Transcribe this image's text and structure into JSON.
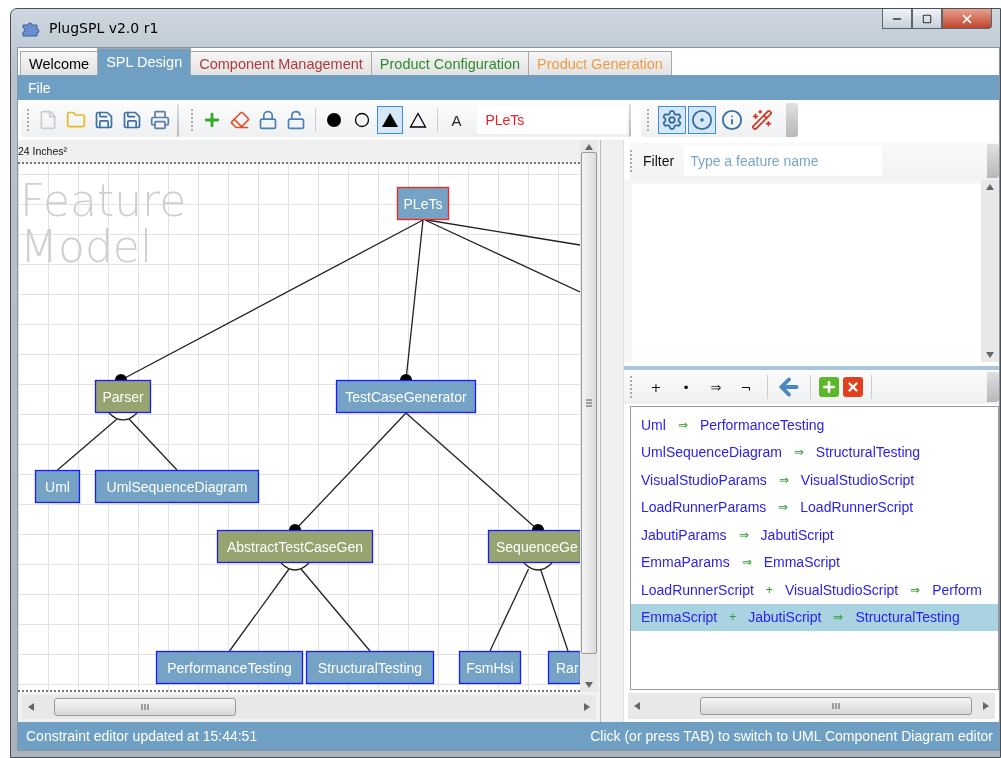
{
  "window": {
    "title": "PlugSPL v2.0 r1"
  },
  "tabs": [
    {
      "label": "Welcome",
      "selected": false,
      "color": "#000000"
    },
    {
      "label": "SPL Design",
      "selected": true,
      "color": "#ffffff"
    },
    {
      "label": "Component Management",
      "selected": false,
      "color": "#b03a3a"
    },
    {
      "label": "Product Configuration",
      "selected": false,
      "color": "#2e8b2e"
    },
    {
      "label": "Product Generation",
      "selected": false,
      "color": "#f39a40"
    }
  ],
  "menu": [
    "File"
  ],
  "toolbar": {
    "file_tools": [
      {
        "kind": "new"
      },
      {
        "kind": "open"
      },
      {
        "kind": "save"
      },
      {
        "kind": "save-as"
      },
      {
        "kind": "print"
      }
    ],
    "edit_tools": [
      {
        "kind": "add"
      },
      {
        "kind": "erase"
      },
      {
        "kind": "lock"
      },
      {
        "kind": "unlock"
      }
    ],
    "shape_tools": [
      {
        "kind": "filled-circle",
        "selected": false
      },
      {
        "kind": "circle",
        "selected": false
      },
      {
        "kind": "filled-triangle",
        "selected": true
      },
      {
        "kind": "triangle",
        "selected": false
      }
    ],
    "font_button": "A",
    "name_field": {
      "value": "PLeTs"
    }
  },
  "view_tools": [
    {
      "kind": "settings",
      "selected": true
    },
    {
      "kind": "target",
      "selected": true
    },
    {
      "kind": "info",
      "selected": false
    },
    {
      "kind": "wand",
      "selected": false
    }
  ],
  "canvas": {
    "ruler": "24 Inches²",
    "watermark": "Feature Model",
    "tree": {
      "label": "PLeTs",
      "kind": "feature",
      "selected": true,
      "children": [
        {
          "label": "Parser",
          "kind": "group",
          "selected": false,
          "children": [
            {
              "label": "Uml",
              "kind": "feature",
              "selected": false
            },
            {
              "label": "UmlSequenceDiagram",
              "kind": "feature",
              "selected": false
            }
          ]
        },
        {
          "label": "TestCaseGenerator",
          "kind": "feature",
          "selected": false,
          "children": [
            {
              "label": "AbstractTestCaseGen",
              "kind": "group",
              "selected": false,
              "children": [
                {
                  "label": "PerformanceTesting",
                  "kind": "feature",
                  "selected": false
                },
                {
                  "label": "StructuralTesting",
                  "kind": "feature",
                  "selected": false
                }
              ]
            },
            {
              "label": "SequenceGe",
              "kind": "group",
              "selected": false,
              "children": [
                {
                  "label": "FsmHsi",
                  "kind": "feature",
                  "selected": false
                },
                {
                  "label": "Rar",
                  "kind": "feature",
                  "selected": false
                }
              ]
            }
          ]
        }
      ]
    }
  },
  "filter": {
    "label": "Filter",
    "placeholder": "Type a feature name"
  },
  "constraint_tools": [
    {
      "kind": "operator",
      "label": "+"
    },
    {
      "kind": "operator",
      "label": "•"
    },
    {
      "kind": "operator",
      "label": "⇒"
    },
    {
      "kind": "operator",
      "label": "¬"
    },
    {
      "kind": "back"
    },
    {
      "kind": "add"
    },
    {
      "kind": "delete"
    }
  ],
  "constraints": [
    {
      "selected": false,
      "tokens": [
        {
          "kind": "feature",
          "text": "Uml"
        },
        {
          "kind": "operator",
          "text": "⇒"
        },
        {
          "kind": "feature",
          "text": "PerformanceTesting"
        }
      ]
    },
    {
      "selected": false,
      "tokens": [
        {
          "kind": "feature",
          "text": "UmlSequenceDiagram"
        },
        {
          "kind": "operator",
          "text": "⇒"
        },
        {
          "kind": "feature",
          "text": "StructuralTesting"
        }
      ]
    },
    {
      "selected": false,
      "tokens": [
        {
          "kind": "feature",
          "text": "VisualStudioParams"
        },
        {
          "kind": "operator",
          "text": "⇒"
        },
        {
          "kind": "feature",
          "text": "VisualStudioScript"
        }
      ]
    },
    {
      "selected": false,
      "tokens": [
        {
          "kind": "feature",
          "text": "LoadRunnerParams"
        },
        {
          "kind": "operator",
          "text": "⇒"
        },
        {
          "kind": "feature",
          "text": "LoadRunnerScript"
        }
      ]
    },
    {
      "selected": false,
      "tokens": [
        {
          "kind": "feature",
          "text": "JabutiParams"
        },
        {
          "kind": "operator",
          "text": "⇒"
        },
        {
          "kind": "feature",
          "text": "JabutiScript"
        }
      ]
    },
    {
      "selected": false,
      "tokens": [
        {
          "kind": "feature",
          "text": "EmmaParams"
        },
        {
          "kind": "operator",
          "text": "⇒"
        },
        {
          "kind": "feature",
          "text": "EmmaScript"
        }
      ]
    },
    {
      "selected": false,
      "tokens": [
        {
          "kind": "feature",
          "text": "LoadRunnerScript"
        },
        {
          "kind": "operator",
          "text": "+"
        },
        {
          "kind": "feature",
          "text": "VisualStudioScript"
        },
        {
          "kind": "operator",
          "text": "⇒"
        },
        {
          "kind": "feature",
          "text": "Perform"
        }
      ]
    },
    {
      "selected": true,
      "tokens": [
        {
          "kind": "feature",
          "text": "EmmaScript"
        },
        {
          "kind": "operator",
          "text": "+"
        },
        {
          "kind": "feature",
          "text": "JabutiScript"
        },
        {
          "kind": "operator",
          "text": "⇒"
        },
        {
          "kind": "feature",
          "text": "StructuralTesting"
        }
      ]
    }
  ],
  "status_bar": {
    "left": "Constraint editor updated at 15:44:51",
    "right": "Click (or press TAB) to switch to UML Component Diagram editor"
  }
}
